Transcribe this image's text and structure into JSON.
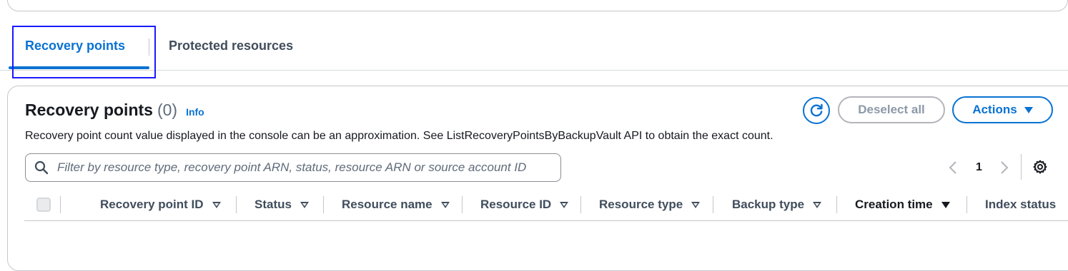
{
  "tabs": [
    {
      "label": "Recovery points",
      "active": true
    },
    {
      "label": "Protected resources",
      "active": false
    }
  ],
  "panel": {
    "title": "Recovery points",
    "count": "(0)",
    "info_link": "Info",
    "description": "Recovery point count value displayed in the console can be an approximation. See ListRecoveryPointsByBackupVault API to obtain the exact count."
  },
  "toolbar": {
    "refresh_icon": "refresh-icon",
    "deselect_label": "Deselect all",
    "actions_label": "Actions"
  },
  "search": {
    "placeholder": "Filter by resource type, recovery point ARN, status, resource ARN or source account ID",
    "value": ""
  },
  "pagination": {
    "current_page": "1"
  },
  "table": {
    "columns": [
      {
        "label": "Recovery point ID",
        "sort": "none"
      },
      {
        "label": "Status",
        "sort": "none"
      },
      {
        "label": "Resource name",
        "sort": "none"
      },
      {
        "label": "Resource ID",
        "sort": "none"
      },
      {
        "label": "Resource type",
        "sort": "none"
      },
      {
        "label": "Backup type",
        "sort": "none"
      },
      {
        "label": "Creation time",
        "sort": "descending"
      },
      {
        "label": "Index status",
        "sort": "none"
      }
    ],
    "rows": []
  },
  "colors": {
    "accent": "#0972d3",
    "focus_outline": "#1a1aff",
    "disabled_text": "#8d99a8"
  }
}
